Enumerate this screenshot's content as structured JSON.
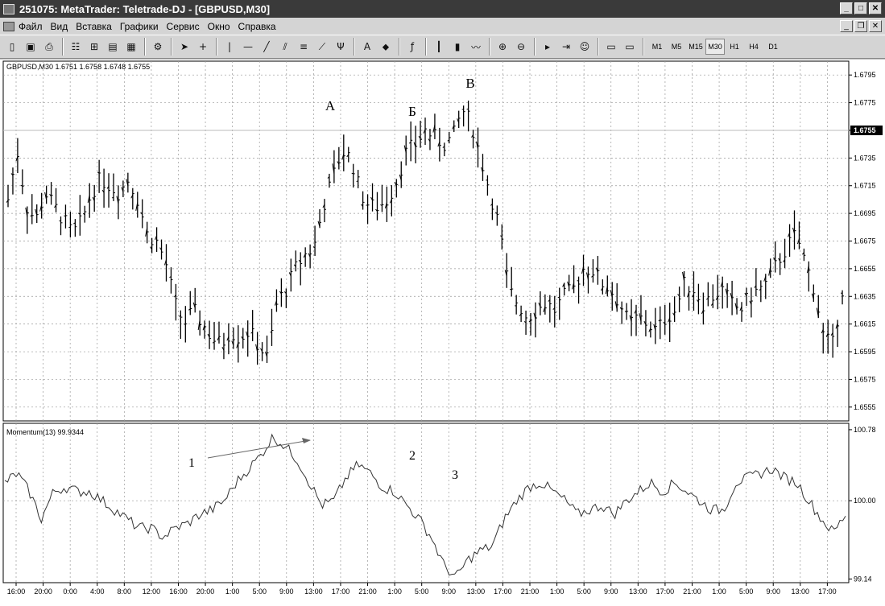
{
  "window": {
    "title": "251075: MetaTrader: Teletrade-DJ - [GBPUSD,M30]"
  },
  "menu": [
    "Файл",
    "Вид",
    "Вставка",
    "Графики",
    "Сервис",
    "Окно",
    "Справка"
  ],
  "toolbar": {
    "tools": [
      "new-chart-icon",
      "save-icon",
      "print-icon",
      "market-watch-icon",
      "data-window-icon",
      "navigator-icon",
      "terminal-icon",
      "properties-icon",
      "cursor-icon",
      "crosshair-icon",
      "vertical-line-icon",
      "horizontal-line-icon",
      "trendline-icon",
      "channel-icon",
      "fibo-retracement-icon",
      "fibo-fan-icon",
      "gann-icon",
      "text-icon",
      "arrow-label-icon",
      "period-separator-icon",
      "bar-chart-icon",
      "candle-chart-icon",
      "line-chart-icon",
      "zoom-in-icon",
      "zoom-out-icon",
      "chart-shift-icon",
      "autoscroll-icon",
      "expert-icon",
      "template-icon",
      "profile-icon"
    ],
    "timeframes": [
      "M1",
      "M5",
      "M15",
      "M30",
      "H1",
      "H4",
      "D1"
    ],
    "active_timeframe": "M30"
  },
  "chart": {
    "symbol_info": "GBPUSD,M30  1.6751 1.6758 1.6748 1.6755",
    "price_labels": [
      "1.6795",
      "1.6775",
      "1.6755",
      "1.6735",
      "1.6715",
      "1.6695",
      "1.6675",
      "1.6655",
      "1.6635",
      "1.6615",
      "1.6595",
      "1.6575",
      "1.6555"
    ],
    "current_price": "1.6755",
    "annotations": [
      "А",
      "Б",
      "В"
    ],
    "indicator_info": "Momentum(13)  99.9344",
    "indicator_labels": [
      "100.78",
      "100.00",
      "99.14"
    ],
    "indicator_annotations": [
      "1",
      "2",
      "3"
    ],
    "time_labels": [
      "16:00",
      "20:00",
      "0:00",
      "4:00",
      "8:00",
      "12:00",
      "16:00",
      "20:00",
      "1:00",
      "5:00",
      "9:00",
      "13:00",
      "17:00",
      "21:00",
      "1:00",
      "5:00",
      "9:00",
      "13:00",
      "17:00",
      "21:00",
      "1:00",
      "5:00",
      "9:00",
      "13:00",
      "17:00",
      "21:00",
      "1:00",
      "5:00",
      "9:00",
      "13:00",
      "17:00"
    ]
  },
  "chart_data": {
    "type": "line",
    "title": "GBPUSD,M30",
    "series": [
      {
        "name": "GBPUSD,M30",
        "values": [
          1.6705,
          1.674,
          1.67,
          1.669,
          1.671,
          1.67,
          1.669,
          1.668,
          1.669,
          1.671,
          1.672,
          1.6715,
          1.671,
          1.672,
          1.6705,
          1.668,
          1.6675,
          1.666,
          1.663,
          1.6615,
          1.6625,
          1.6615,
          1.6605,
          1.66,
          1.661,
          1.6605,
          1.661,
          1.66,
          1.659,
          1.663,
          1.664,
          1.6655,
          1.6665,
          1.667,
          1.67,
          1.672,
          1.674,
          1.6735,
          1.671,
          1.67,
          1.67,
          1.6705,
          1.672,
          1.674,
          1.6745,
          1.6755,
          1.675,
          1.6745,
          1.675,
          1.677,
          1.676,
          1.6735,
          1.671,
          1.6685,
          1.664,
          1.663,
          1.662,
          1.6625,
          1.663,
          1.6625,
          1.6635,
          1.664,
          1.6655,
          1.6655,
          1.6645,
          1.664,
          1.663,
          1.6615,
          1.662,
          1.6615,
          1.661,
          1.662,
          1.6625,
          1.6645,
          1.664,
          1.663,
          1.6635,
          1.664,
          1.663,
          1.6625,
          1.6635,
          1.664,
          1.6645,
          1.666,
          1.667,
          1.668,
          1.666,
          1.664,
          1.6605,
          1.66,
          1.664
        ]
      },
      {
        "name": "Momentum(13)",
        "values": [
          100.2,
          100.3,
          100.1,
          99.8,
          100.1,
          100.15,
          100.1,
          100.1,
          100.0,
          99.9,
          99.8,
          99.7,
          99.7,
          99.6,
          99.7,
          99.75,
          99.85,
          99.9,
          100.0,
          100.2,
          100.35,
          100.5,
          100.7,
          100.6,
          100.45,
          100.2,
          99.95,
          100.0,
          100.25,
          100.4,
          100.3,
          100.15,
          100.1,
          99.95,
          99.8,
          99.6,
          99.3,
          99.15,
          99.35,
          99.45,
          99.5,
          99.8,
          100.0,
          100.15,
          100.2,
          100.1,
          100.0,
          99.85,
          99.9,
          99.95,
          99.85,
          100.0,
          100.1,
          100.2,
          100.1,
          100.2,
          100.1,
          100.0,
          99.9,
          99.9,
          100.2,
          100.25,
          100.3,
          100.35,
          100.25,
          100.2,
          100.0,
          99.8,
          99.65,
          99.85
        ]
      }
    ],
    "ylim": [
      1.6545,
      1.6805
    ],
    "grid": true
  }
}
